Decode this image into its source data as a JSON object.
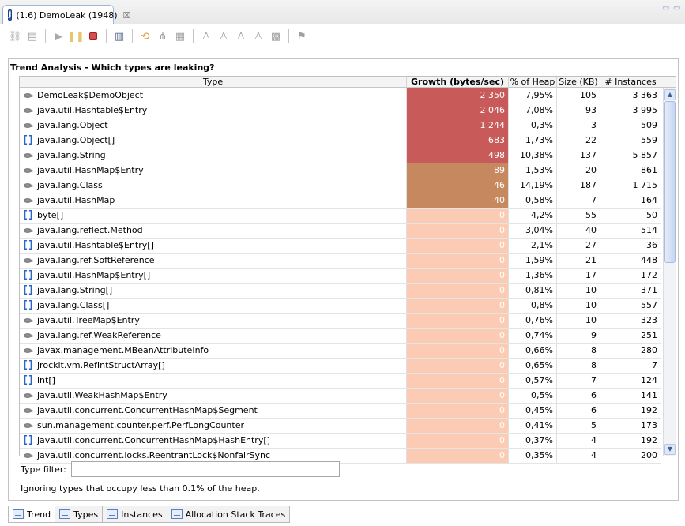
{
  "editor_tab": {
    "title": "(1.6) DemoLeak (1948)",
    "close": "☒"
  },
  "window_controls": {
    "minimize": "▭",
    "maximize": "▭"
  },
  "toolbar": {
    "icons": [
      "disconnect-icon",
      "gc-icon",
      "play-icon",
      "pause-icon",
      "stop-icon",
      "trash-icon",
      "refresh-icon",
      "filter-icon",
      "table-icon",
      "user-icon",
      "user-add-icon",
      "user-search-icon",
      "user-count-icon",
      "export-icon",
      "settings-icon"
    ]
  },
  "pane": {
    "title": "Trend Analysis - Which types are leaking?"
  },
  "columns": {
    "type": "Type",
    "growth": "Growth (bytes/sec)",
    "heap": "% of Heap",
    "size": "Size (KB)",
    "instances": "# Instances"
  },
  "rows": [
    {
      "icon": "class",
      "type": "DemoLeak$DemoObject",
      "growth": "2 350",
      "heap": "7,95%",
      "size": "105",
      "instances": "3 363",
      "color": "#c85a5a"
    },
    {
      "icon": "class",
      "type": "java.util.Hashtable$Entry",
      "growth": "2 046",
      "heap": "7,08%",
      "size": "93",
      "instances": "3 995",
      "color": "#c85a5a"
    },
    {
      "icon": "class",
      "type": "java.lang.Object",
      "growth": "1 244",
      "heap": "0,3%",
      "size": "3",
      "instances": "509",
      "color": "#c85a5a"
    },
    {
      "icon": "array",
      "type": "java.lang.Object[]",
      "growth": "683",
      "heap": "1,73%",
      "size": "22",
      "instances": "559",
      "color": "#c85a5a"
    },
    {
      "icon": "class",
      "type": "java.lang.String",
      "growth": "498",
      "heap": "10,38%",
      "size": "137",
      "instances": "5 857",
      "color": "#c85a5a"
    },
    {
      "icon": "class",
      "type": "java.util.HashMap$Entry",
      "growth": "89",
      "heap": "1,53%",
      "size": "20",
      "instances": "861",
      "color": "#c6885e"
    },
    {
      "icon": "class",
      "type": "java.lang.Class",
      "growth": "46",
      "heap": "14,19%",
      "size": "187",
      "instances": "1 715",
      "color": "#c6885e"
    },
    {
      "icon": "class",
      "type": "java.util.HashMap",
      "growth": "40",
      "heap": "0,58%",
      "size": "7",
      "instances": "164",
      "color": "#c6885e"
    },
    {
      "icon": "array",
      "type": "byte[]",
      "growth": "0",
      "heap": "4,2%",
      "size": "55",
      "instances": "50",
      "color": "#fbcbb4"
    },
    {
      "icon": "class",
      "type": "java.lang.reflect.Method",
      "growth": "0",
      "heap": "3,04%",
      "size": "40",
      "instances": "514",
      "color": "#fbcbb4"
    },
    {
      "icon": "array",
      "type": "java.util.Hashtable$Entry[]",
      "growth": "0",
      "heap": "2,1%",
      "size": "27",
      "instances": "36",
      "color": "#fbcbb4"
    },
    {
      "icon": "class",
      "type": "java.lang.ref.SoftReference",
      "growth": "0",
      "heap": "1,59%",
      "size": "21",
      "instances": "448",
      "color": "#fbcbb4"
    },
    {
      "icon": "array",
      "type": "java.util.HashMap$Entry[]",
      "growth": "0",
      "heap": "1,36%",
      "size": "17",
      "instances": "172",
      "color": "#fbcbb4"
    },
    {
      "icon": "array",
      "type": "java.lang.String[]",
      "growth": "0",
      "heap": "0,81%",
      "size": "10",
      "instances": "371",
      "color": "#fbcbb4"
    },
    {
      "icon": "array",
      "type": "java.lang.Class[]",
      "growth": "0",
      "heap": "0,8%",
      "size": "10",
      "instances": "557",
      "color": "#fbcbb4"
    },
    {
      "icon": "class",
      "type": "java.util.TreeMap$Entry",
      "growth": "0",
      "heap": "0,76%",
      "size": "10",
      "instances": "323",
      "color": "#fbcbb4"
    },
    {
      "icon": "class",
      "type": "java.lang.ref.WeakReference",
      "growth": "0",
      "heap": "0,74%",
      "size": "9",
      "instances": "251",
      "color": "#fbcbb4"
    },
    {
      "icon": "class",
      "type": "javax.management.MBeanAttributeInfo",
      "growth": "0",
      "heap": "0,66%",
      "size": "8",
      "instances": "280",
      "color": "#fbcbb4"
    },
    {
      "icon": "array",
      "type": "jrockit.vm.RefIntStructArray[]",
      "growth": "0",
      "heap": "0,65%",
      "size": "8",
      "instances": "7",
      "color": "#fbcbb4"
    },
    {
      "icon": "array",
      "type": "int[]",
      "growth": "0",
      "heap": "0,57%",
      "size": "7",
      "instances": "124",
      "color": "#fbcbb4"
    },
    {
      "icon": "class",
      "type": "java.util.WeakHashMap$Entry",
      "growth": "0",
      "heap": "0,5%",
      "size": "6",
      "instances": "141",
      "color": "#fbcbb4"
    },
    {
      "icon": "class",
      "type": "java.util.concurrent.ConcurrentHashMap$Segment",
      "growth": "0",
      "heap": "0,45%",
      "size": "6",
      "instances": "192",
      "color": "#fbcbb4"
    },
    {
      "icon": "class",
      "type": "sun.management.counter.perf.PerfLongCounter",
      "growth": "0",
      "heap": "0,41%",
      "size": "5",
      "instances": "173",
      "color": "#fbcbb4"
    },
    {
      "icon": "array",
      "type": "java.util.concurrent.ConcurrentHashMap$HashEntry[]",
      "growth": "0",
      "heap": "0,37%",
      "size": "4",
      "instances": "192",
      "color": "#fbcbb4"
    },
    {
      "icon": "class",
      "type": "java.util.concurrent.locks.ReentrantLock$NonfairSync",
      "growth": "0",
      "heap": "0,35%",
      "size": "4",
      "instances": "200",
      "color": "#fbcbb4"
    }
  ],
  "filter": {
    "label": "Type filter:",
    "value": "",
    "placeholder": ""
  },
  "info": "Ignoring types that occupy less than 0.1% of the heap.",
  "bottom_tabs": [
    {
      "label": "Trend",
      "active": true
    },
    {
      "label": "Types",
      "active": false
    },
    {
      "label": "Instances",
      "active": false
    },
    {
      "label": "Allocation Stack Traces",
      "active": false
    }
  ]
}
